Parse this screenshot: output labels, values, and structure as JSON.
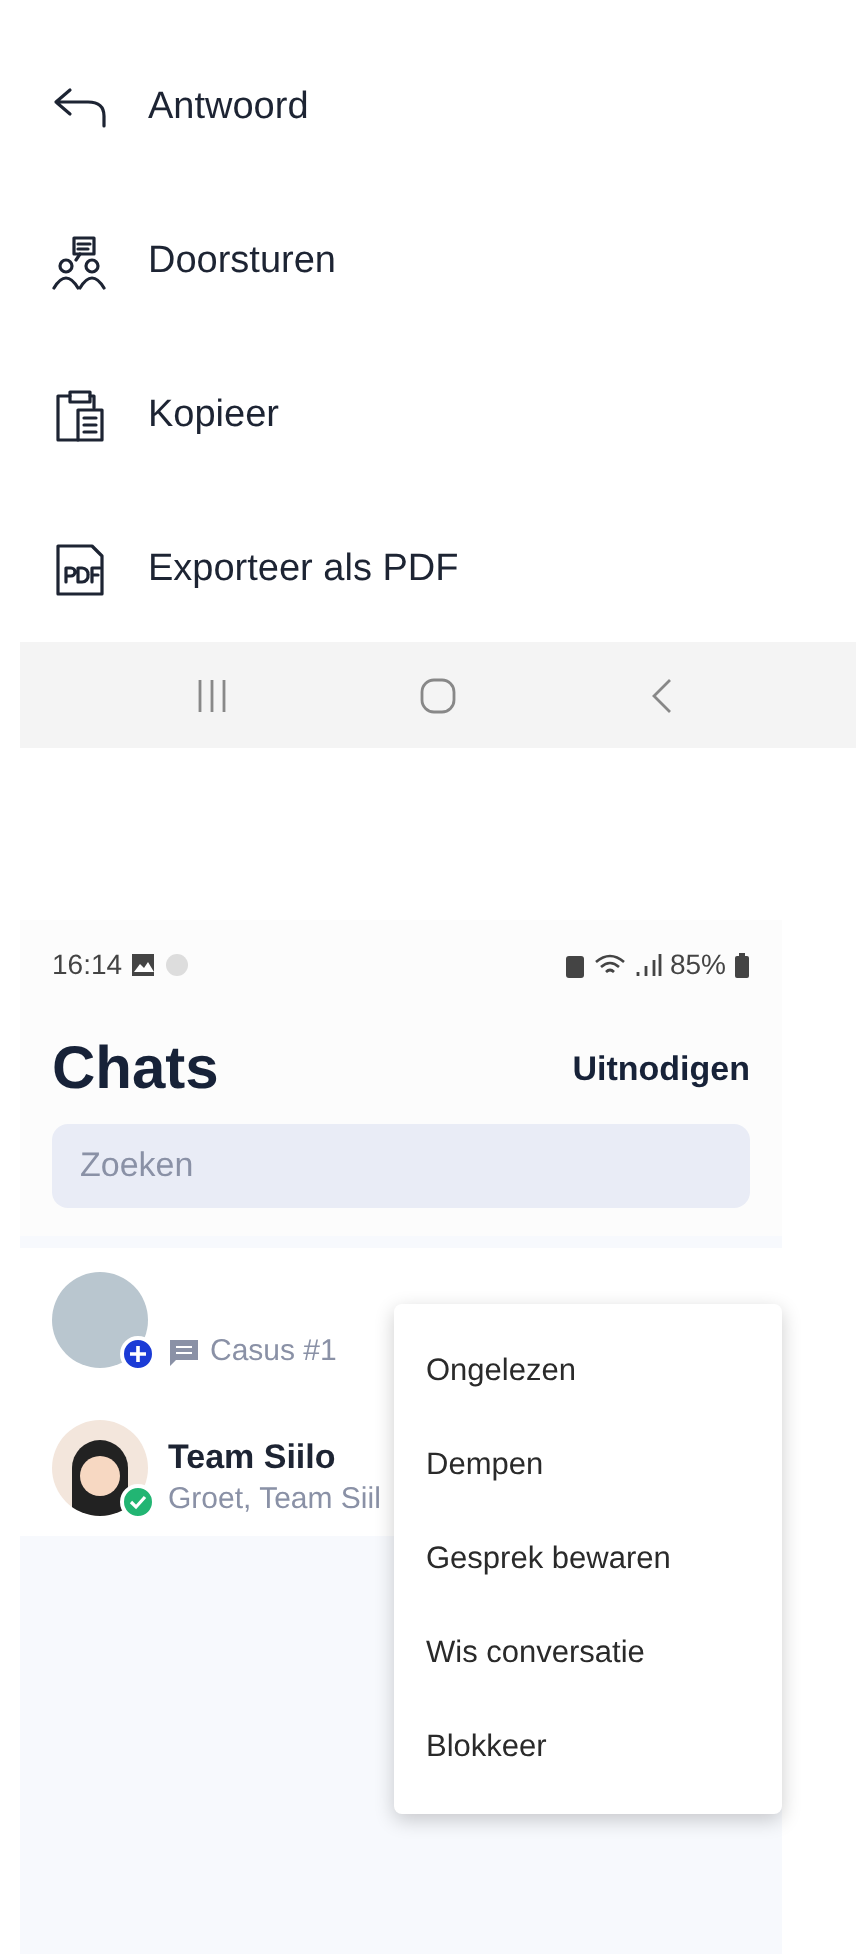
{
  "action_sheet": {
    "items": [
      {
        "kind": "reply",
        "label": "Antwoord"
      },
      {
        "kind": "forward",
        "label": "Doorsturen"
      },
      {
        "kind": "copy",
        "label": "Kopieer"
      },
      {
        "kind": "pdf",
        "label": "Exporteer als PDF"
      }
    ]
  },
  "nav_bar": [
    {
      "kind": "recents"
    },
    {
      "kind": "home"
    },
    {
      "kind": "back"
    }
  ],
  "status_bar": {
    "time": "16:14",
    "battery": "85%"
  },
  "header": {
    "title": "Chats",
    "action": "Uitnodigen"
  },
  "search": {
    "placeholder": "Zoeken"
  },
  "chats": [
    {
      "avatar": {
        "kind": "photo"
      },
      "badge": {
        "kind": "add"
      },
      "preview": "Casus #1",
      "preview_icon": true
    },
    {
      "avatar": {
        "kind": "emoji"
      },
      "badge": {
        "kind": "verified"
      },
      "name": "Team Siilo",
      "preview": "Groet, Team Siil",
      "preview_icon": false
    }
  ],
  "context_menu": {
    "items": [
      "Ongelezen",
      "Dempen",
      "Gesprek bewaren",
      "Wis conversatie",
      "Blokkeer"
    ]
  }
}
